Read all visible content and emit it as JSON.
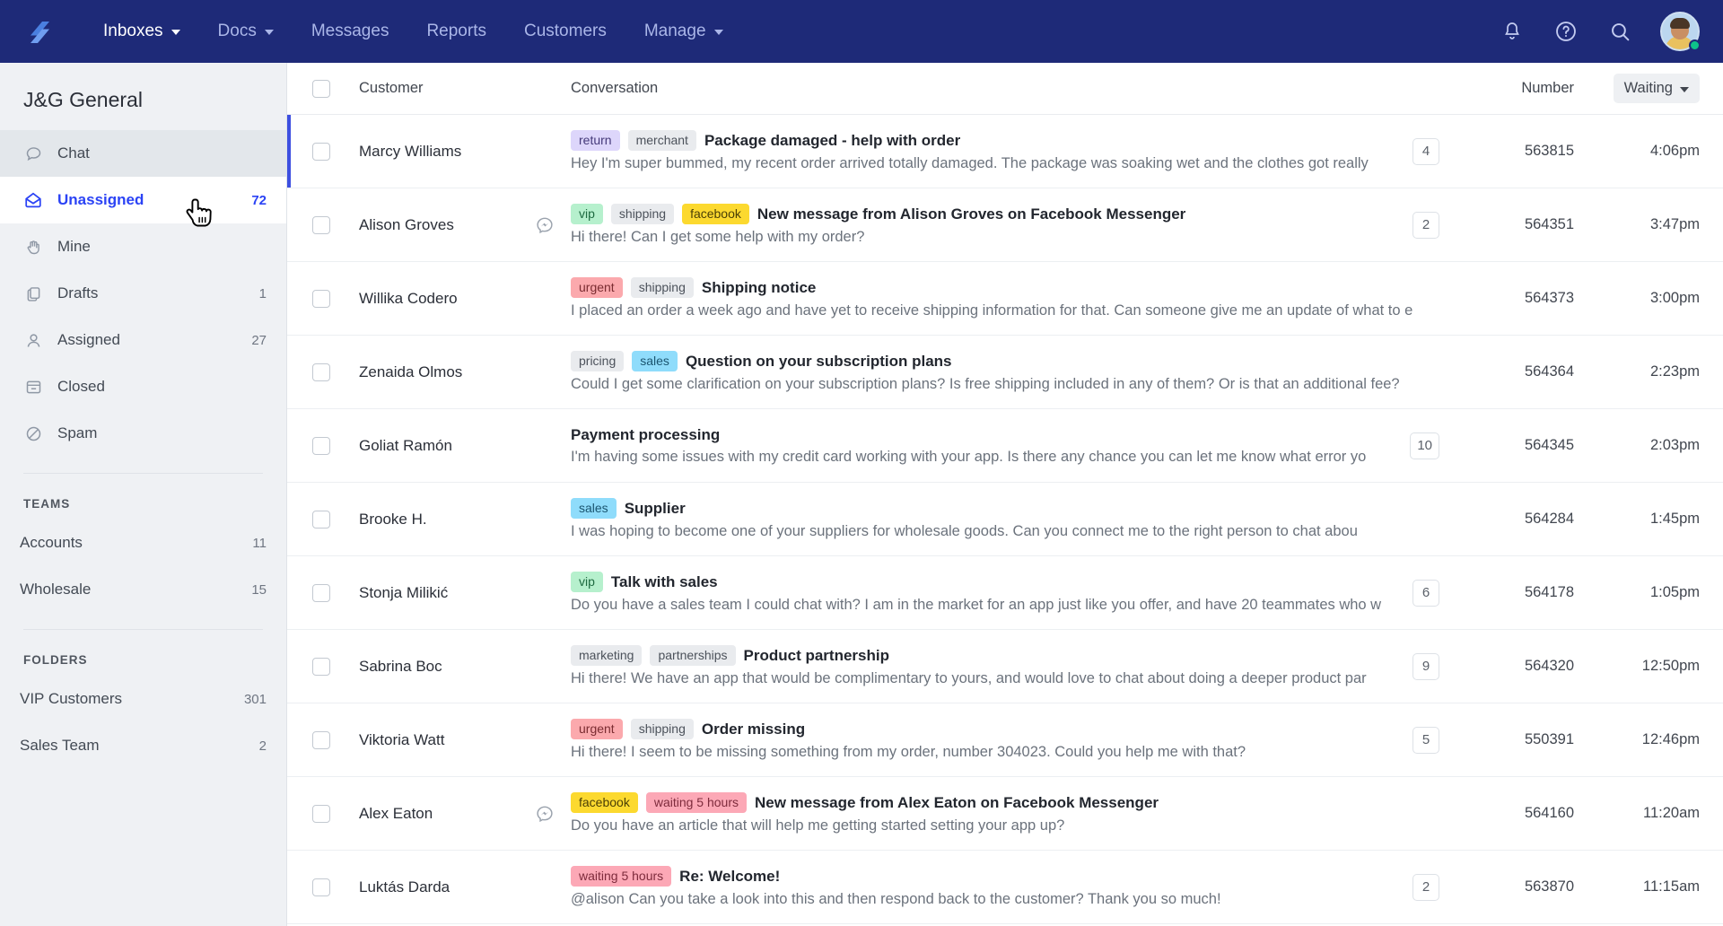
{
  "topnav": {
    "logo": "helpscout-logo",
    "items": [
      {
        "label": "Inboxes",
        "caret": true,
        "active": true
      },
      {
        "label": "Docs",
        "caret": true,
        "active": false
      },
      {
        "label": "Messages",
        "caret": false,
        "active": false
      },
      {
        "label": "Reports",
        "caret": false,
        "active": false
      },
      {
        "label": "Customers",
        "caret": false,
        "active": false
      },
      {
        "label": "Manage",
        "caret": true,
        "active": false
      }
    ],
    "icons": [
      "bell-icon",
      "help-icon",
      "search-icon"
    ],
    "avatar": "user-avatar",
    "accent": "#1e2a78"
  },
  "sidebar": {
    "title": "J&G General",
    "items": [
      {
        "label": "Chat",
        "icon": "chat-bubble-icon",
        "count": "",
        "state": "hover"
      },
      {
        "label": "Unassigned",
        "icon": "open-envelope-icon",
        "count": "72",
        "state": "selected"
      },
      {
        "label": "Mine",
        "icon": "hand-icon",
        "count": "",
        "state": ""
      },
      {
        "label": "Drafts",
        "icon": "drafts-icon",
        "count": "1",
        "state": ""
      },
      {
        "label": "Assigned",
        "icon": "person-icon",
        "count": "27",
        "state": ""
      },
      {
        "label": "Closed",
        "icon": "archive-icon",
        "count": "",
        "state": ""
      },
      {
        "label": "Spam",
        "icon": "block-icon",
        "count": "",
        "state": ""
      }
    ],
    "teams_heading": "TEAMS",
    "teams": [
      {
        "label": "Accounts",
        "count": "11"
      },
      {
        "label": "Wholesale",
        "count": "15"
      }
    ],
    "folders_heading": "FOLDERS",
    "folders": [
      {
        "label": "VIP Customers",
        "count": "301"
      },
      {
        "label": "Sales Team",
        "count": "2"
      }
    ]
  },
  "table": {
    "headers": {
      "customer": "Customer",
      "conversation": "Conversation",
      "number": "Number",
      "sort": "Waiting"
    },
    "rows": [
      {
        "customer": "Marcy Williams",
        "tags": [
          {
            "text": "return",
            "color": "purple"
          },
          {
            "text": "merchant",
            "color": "grey"
          }
        ],
        "subject": "Package damaged - help with order",
        "preview": "Hey I'm super bummed, my recent order arrived totally damaged. The package was soaking wet and the clothes got really",
        "count": "4",
        "channel": "",
        "number": "563815",
        "time": "4:06pm",
        "selected": true
      },
      {
        "customer": "Alison Groves",
        "tags": [
          {
            "text": "vip",
            "color": "green"
          },
          {
            "text": "shipping",
            "color": "grey"
          },
          {
            "text": "facebook",
            "color": "yellow"
          }
        ],
        "subject": "New message from Alison Groves on Facebook Messenger",
        "preview": "Hi there! Can I get some help with my order?",
        "count": "2",
        "channel": "messenger-icon",
        "number": "564351",
        "time": "3:47pm",
        "selected": false
      },
      {
        "customer": "Willika Codero",
        "tags": [
          {
            "text": "urgent",
            "color": "red"
          },
          {
            "text": "shipping",
            "color": "grey"
          }
        ],
        "subject": "Shipping notice",
        "preview": "I placed an order a week ago and have yet to receive shipping information for that. Can someone give me an update of what to e",
        "count": "",
        "channel": "",
        "number": "564373",
        "time": "3:00pm",
        "selected": false
      },
      {
        "customer": "Zenaida Olmos",
        "tags": [
          {
            "text": "pricing",
            "color": "grey"
          },
          {
            "text": "sales",
            "color": "blue"
          }
        ],
        "subject": "Question on your subscription plans",
        "preview": "Could I get some clarification on your subscription plans? Is free shipping included in any of them? Or is that an additional fee?",
        "count": "",
        "channel": "",
        "number": "564364",
        "time": "2:23pm",
        "selected": false
      },
      {
        "customer": "Goliat Ramón",
        "tags": [],
        "subject": "Payment processing",
        "preview": "I'm having some issues with my credit card working with your app. Is there any chance you can let me know what error yo",
        "count": "10",
        "channel": "",
        "number": "564345",
        "time": "2:03pm",
        "selected": false
      },
      {
        "customer": "Brooke H.",
        "tags": [
          {
            "text": "sales",
            "color": "blue"
          }
        ],
        "subject": "Supplier",
        "preview": "I was hoping to become one of your suppliers for wholesale goods. Can you connect me to the right person to chat abou",
        "count": "",
        "channel": "",
        "number": "564284",
        "time": "1:45pm",
        "selected": false
      },
      {
        "customer": "Stonja Milikić",
        "tags": [
          {
            "text": "vip",
            "color": "green"
          }
        ],
        "subject": "Talk with sales",
        "preview": "Do you have a sales team I could chat with? I am in the market for an app just like you offer, and have 20 teammates who w",
        "count": "6",
        "channel": "",
        "number": "564178",
        "time": "1:05pm",
        "selected": false
      },
      {
        "customer": "Sabrina Boc",
        "tags": [
          {
            "text": "marketing",
            "color": "grey"
          },
          {
            "text": "partnerships",
            "color": "grey"
          }
        ],
        "subject": "Product partnership",
        "preview": "Hi there! We have an app that would be complimentary to yours, and would love to chat about doing a deeper product par",
        "count": "9",
        "channel": "",
        "number": "564320",
        "time": "12:50pm",
        "selected": false
      },
      {
        "customer": "Viktoria Watt",
        "tags": [
          {
            "text": "urgent",
            "color": "red"
          },
          {
            "text": "shipping",
            "color": "grey"
          }
        ],
        "subject": "Order missing",
        "preview": "Hi there! I seem to be missing something from my order, number 304023. Could you help me with that?",
        "count": "5",
        "channel": "",
        "number": "550391",
        "time": "12:46pm",
        "selected": false
      },
      {
        "customer": "Alex Eaton",
        "tags": [
          {
            "text": "facebook",
            "color": "yellow"
          },
          {
            "text": "waiting 5 hours",
            "color": "pink"
          }
        ],
        "subject": "New message from Alex Eaton on Facebook Messenger",
        "preview": "Do you have an article that will help me getting started setting your app up?",
        "count": "",
        "channel": "messenger-icon",
        "number": "564160",
        "time": "11:20am",
        "selected": false
      },
      {
        "customer": "Luktás Darda",
        "tags": [
          {
            "text": "waiting 5 hours",
            "color": "pink"
          }
        ],
        "subject": "Re: Welcome!",
        "preview": "@alison Can you take a look into this and then respond back to the customer? Thank you so much!",
        "count": "2",
        "channel": "",
        "number": "563870",
        "time": "11:15am",
        "selected": false
      }
    ]
  }
}
